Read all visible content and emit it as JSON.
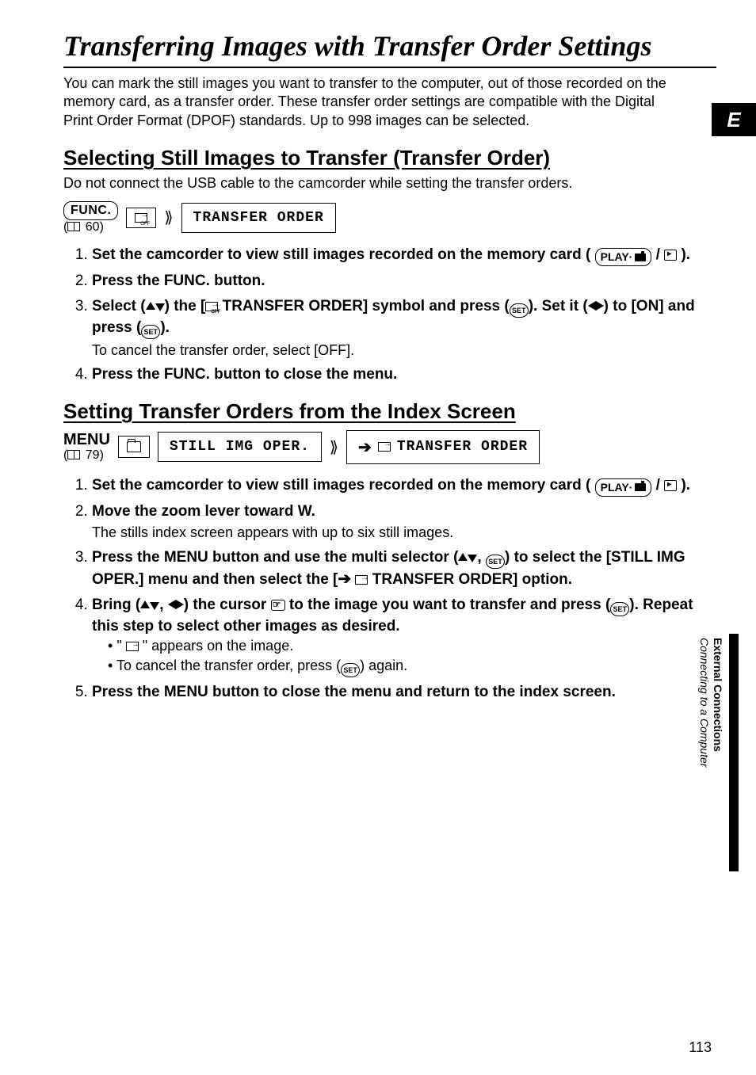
{
  "tab": {
    "letter": "E"
  },
  "sidebar": {
    "section": "External Connections",
    "subsection": "Connecting to a Computer"
  },
  "page": {
    "number": "113"
  },
  "title": "Transferring Images with Transfer Order Settings",
  "intro": "You can mark the still images you want to transfer to the computer, out of those recorded on the memory card, as a transfer order. These transfer order settings are compatible with the Digital Print Order Format (DPOF) standards. Up to 998 images can be selected.",
  "selecting": {
    "heading": "Selecting Still Images to Transfer (Transfer Order)",
    "note": "Do not connect the USB cable to the camcorder while setting the transfer orders.",
    "func": {
      "label": "FUNC.",
      "ref": "60"
    },
    "box": {
      "label": "TRANSFER ORDER"
    },
    "steps": {
      "s1a": "Set the camcorder to view still images recorded on the memory card",
      "play": "PLAY·",
      "s1b": "(",
      "s1c": "/",
      "s1d": ").",
      "s2": "Press the FUNC. button.",
      "s3a": "Select (",
      "s3b": ") the [",
      "s3c": " TRANSFER ORDER] symbol and press (",
      "s3d": "). Set it (",
      "s3e": ") to [ON] and press (",
      "s3f": ").",
      "s3note": "To cancel the transfer order, select [OFF].",
      "s4": "Press the FUNC. button to close the menu."
    }
  },
  "indexscreen": {
    "heading": "Setting Transfer Orders from the Index Screen",
    "menu": {
      "label": "MENU",
      "ref": "79"
    },
    "box1": {
      "label": "STILL IMG OPER."
    },
    "box2": {
      "label": "TRANSFER ORDER"
    },
    "steps": {
      "s1a": "Set the camcorder to view still images recorded on the memory card",
      "play": "PLAY·",
      "s1b": "(",
      "s1c": "/",
      "s1d": ").",
      "s2a": "Move the zoom lever toward ",
      "s2w": "W",
      "s2b": ".",
      "s2note": "The stills index screen appears with up to six still images.",
      "s3a": "Press the MENU button and use the multi selector (",
      "s3b": ", ",
      "s3c": ") to select the [STILL IMG OPER.] menu and then select the [",
      "s3d": " TRANSFER ORDER] option.",
      "s4a": "Bring (",
      "s4b": ", ",
      "s4c": ") the cursor ",
      "s4d": " to the image you want to transfer and press (",
      "s4e": "). Repeat this step to select other images as desired.",
      "s4n1a": "\" ",
      "s4n1b": " \" appears on the image.",
      "s4n2a": "To cancel the transfer order, press (",
      "s4n2b": ") again.",
      "s5": "Press the MENU button to close the menu and return to the index screen."
    }
  }
}
